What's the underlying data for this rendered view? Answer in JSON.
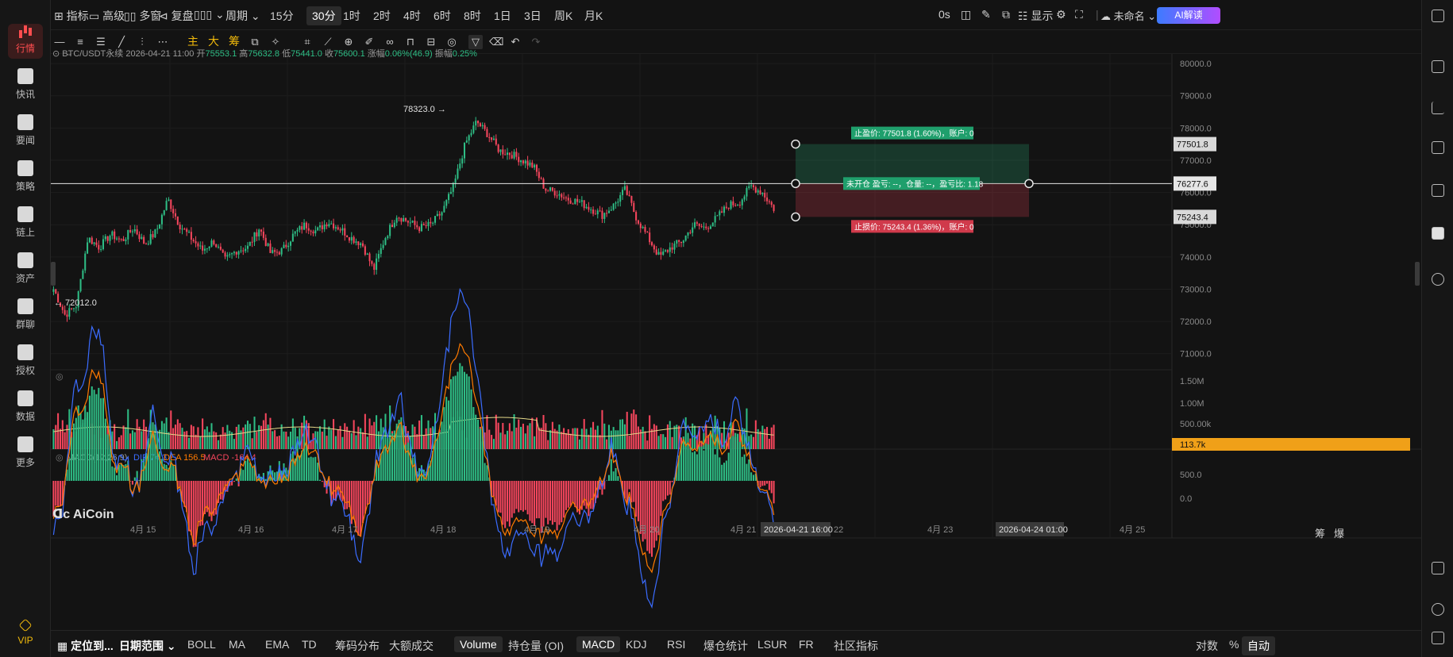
{
  "left_nav": {
    "items": [
      {
        "label": "行情",
        "icon": "bar-chart-icon",
        "active": true
      },
      {
        "label": "快讯",
        "icon": "news-flash-icon"
      },
      {
        "label": "要闻",
        "icon": "document-icon"
      },
      {
        "label": "策略",
        "icon": "robot-icon"
      },
      {
        "label": "链上",
        "icon": "chain-icon"
      },
      {
        "label": "资产",
        "icon": "wallet-icon"
      },
      {
        "label": "群聊",
        "icon": "chat-icon"
      },
      {
        "label": "授权",
        "icon": "key-icon"
      },
      {
        "label": "数据",
        "icon": "monitor-icon"
      },
      {
        "label": "更多",
        "icon": "grid-icon"
      }
    ],
    "vip_label": "VIP"
  },
  "top_bar": {
    "tools": [
      "指标",
      "高级",
      "多窗",
      "复盘"
    ],
    "period_label": "周期",
    "timeframes": [
      "15分",
      "30分",
      "1时",
      "2时",
      "4时",
      "6时",
      "8时",
      "1日",
      "3日",
      "周K",
      "月K"
    ],
    "active_timeframe": "30分",
    "countdown": "0s",
    "display_label": "显示",
    "layout_name": "未命名",
    "ai_label": "AI解读"
  },
  "draw_toolbar": {
    "text_tools": [
      "主",
      "大",
      "筹"
    ]
  },
  "legend": {
    "symbol": "BTC/USDT永续",
    "datetime": "2026-04-21 11:00",
    "open_label": "开",
    "open": "75553.1",
    "high_label": "高",
    "high": "75632.8",
    "low_label": "低",
    "low": "75441.0",
    "close_label": "收",
    "close": "75600.1",
    "change_label": "涨幅",
    "change": "0.06%(46.9)",
    "amplitude_label": "振幅",
    "amplitude": "0.25%"
  },
  "chart_data": {
    "type": "candlestick",
    "price_axis_ticks": [
      "80000.0",
      "79000.0",
      "78000.0",
      "77000.0",
      "76000.0",
      "75000.0",
      "74000.0",
      "73000.0",
      "72000.0",
      "71000.0"
    ],
    "ylim": [
      70500,
      80200
    ],
    "x_labels": [
      "4月 15",
      "4月 16",
      "4月 17",
      "4月 18",
      "4月 19",
      "4月 20",
      "4月 21",
      "22",
      "4月 23",
      "4月 25"
    ],
    "close_path": [
      73000,
      72200,
      72500,
      74600,
      74300,
      74700,
      74500,
      74900,
      74400,
      74800,
      75800,
      75000,
      74600,
      74200,
      74500,
      73900,
      74200,
      74300,
      74900,
      74100,
      74200,
      74700,
      75000,
      74800,
      75100,
      74900,
      74600,
      74400,
      73600,
      74600,
      75300,
      75100,
      74900,
      75000,
      75400,
      76200,
      77500,
      78200,
      77800,
      77300,
      77200,
      77000,
      76800,
      76100,
      76000,
      75800,
      75700,
      75500,
      75300,
      75600,
      76100,
      75200,
      74600,
      74000,
      74300,
      74500,
      75000,
      74900,
      75200,
      75600,
      75700,
      76200,
      76000,
      75500
    ],
    "high_marker": "78323.0",
    "low_marker": "72012.0",
    "current_price": "76277.6",
    "take_profit_price": "77501.8",
    "stop_loss_price": "75243.4",
    "take_profit_label": "止盈价: 77501.8 (1.60%)，账户: 0",
    "stop_loss_label": "止损价: 75243.4 (1.36%)，账户: 0",
    "position_label": "未开仓 盈亏: --，仓量: --，盈亏比: 1.18",
    "volume_axis_ticks": [
      "1.50M",
      "1.00M",
      "500.00k"
    ],
    "volume_current": "113.7k",
    "macd": {
      "label": "MACD(12,26,9)",
      "dif_label": "DIF 74.3",
      "dea_label": "DEA 156.5",
      "macd_label": "MACD -164.4",
      "axis_ticks": [
        "500.0",
        "0.0"
      ]
    },
    "crosshair_time": "2026-04-21 16:00",
    "end_time_marker": "2026-04-24 01:00",
    "colors": {
      "up": "#2ebd85",
      "down": "#f6465d",
      "dif": "#3b6cff",
      "dea": "#ff7a00",
      "vol_ma": "#e5d98a"
    }
  },
  "watermark": "AiCoin",
  "right_panel_labels": [
    "筹",
    "爆"
  ],
  "bottom_bar": {
    "locate_label": "定位到...",
    "date_range_label": "日期范围",
    "indicators": [
      "BOLL",
      "MA",
      "EMA",
      "TD",
      "筹码分布",
      "大额成交",
      "Volume",
      "持仓量 (OI)",
      "MACD",
      "KDJ",
      "RSI",
      "爆仓统计",
      "LSUR",
      "FR",
      "社区指标"
    ],
    "active_indicators": [
      "Volume",
      "MACD"
    ],
    "log_label": "对数",
    "percent_label": "%",
    "auto_label": "自动"
  }
}
